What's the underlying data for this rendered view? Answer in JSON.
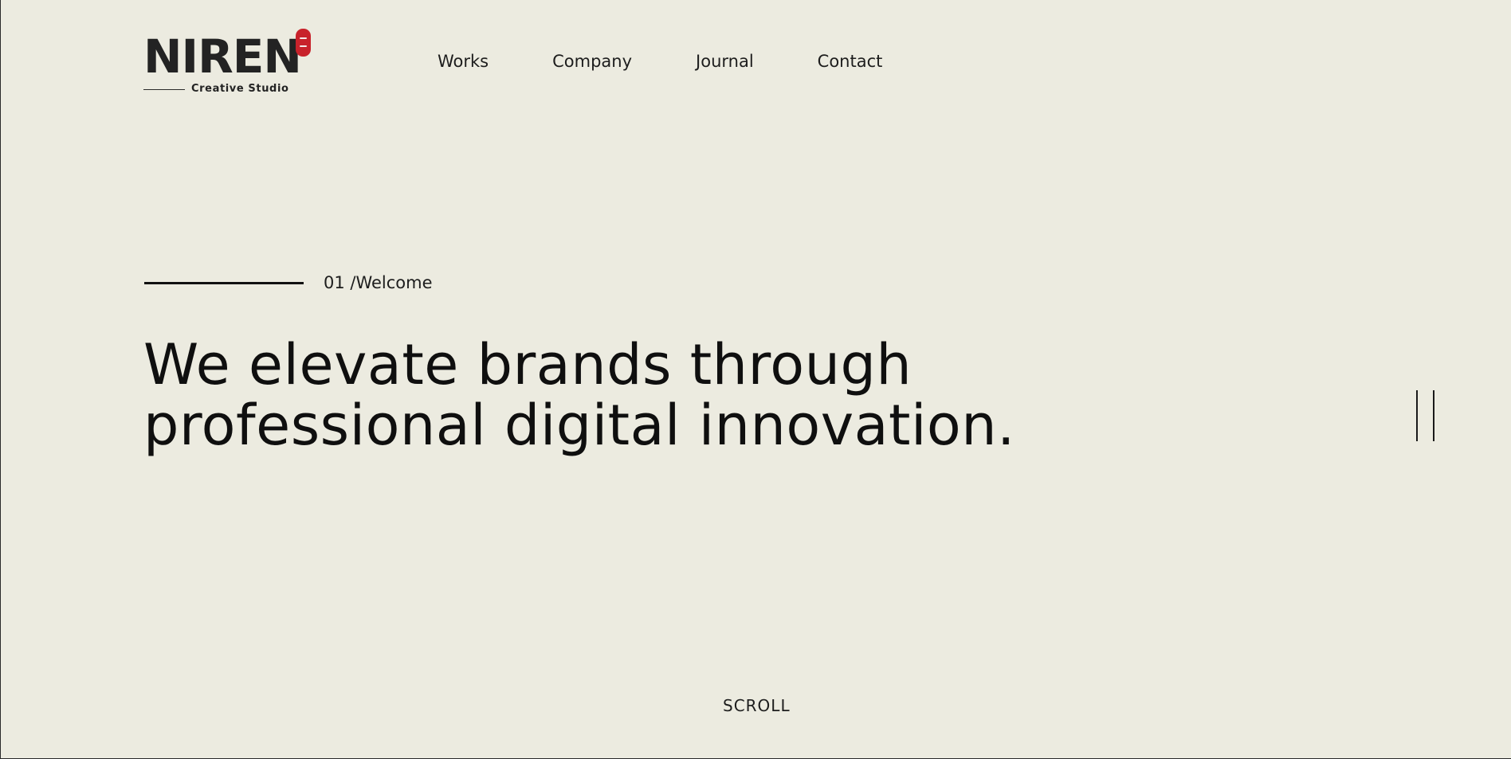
{
  "logo": {
    "wordmark": "NIREN",
    "tagline": "Creative Studio",
    "seal_color": "#c8222b"
  },
  "nav": {
    "items": [
      {
        "label": "Works"
      },
      {
        "label": "Company"
      },
      {
        "label": "Journal"
      },
      {
        "label": "Contact"
      }
    ]
  },
  "hero": {
    "section_label": "01 /Welcome",
    "headline_line1": "We elevate brands through",
    "headline_line2": "professional digital innovation."
  },
  "scroll": {
    "label": "SCROLL"
  },
  "colors": {
    "background": "#ecebe0",
    "text": "#111111",
    "accent": "#c8222b"
  },
  "icons": {
    "side_control": "double-vertical-bars-icon"
  }
}
